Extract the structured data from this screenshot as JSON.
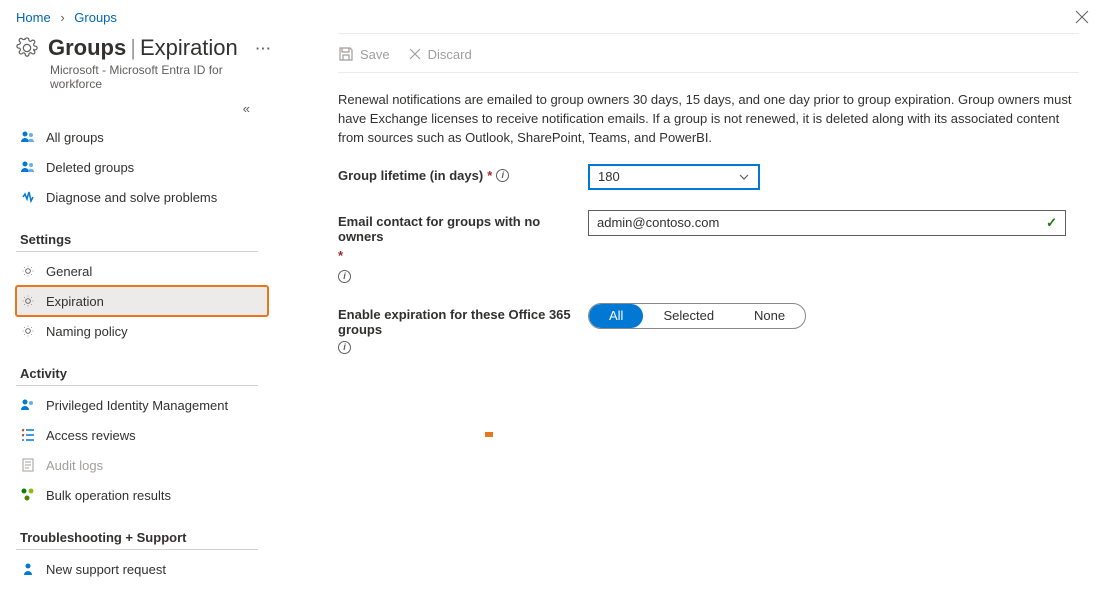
{
  "breadcrumb": {
    "home": "Home",
    "groups": "Groups"
  },
  "header": {
    "title_bold": "Groups",
    "title_rest": "Expiration",
    "subtitle": "Microsoft - Microsoft Entra ID for workforce"
  },
  "sidebar": {
    "top": [
      {
        "label": "All groups"
      },
      {
        "label": "Deleted groups"
      },
      {
        "label": "Diagnose and solve problems"
      }
    ],
    "section_settings": "Settings",
    "settings": [
      {
        "label": "General"
      },
      {
        "label": "Expiration"
      },
      {
        "label": "Naming policy"
      }
    ],
    "section_activity": "Activity",
    "activity": [
      {
        "label": "Privileged Identity Management"
      },
      {
        "label": "Access reviews"
      },
      {
        "label": "Audit logs"
      },
      {
        "label": "Bulk operation results"
      }
    ],
    "section_troubleshoot": "Troubleshooting + Support",
    "support": [
      {
        "label": "New support request"
      }
    ]
  },
  "toolbar": {
    "save": "Save",
    "discard": "Discard"
  },
  "info": "Renewal notifications are emailed to group owners 30 days, 15 days, and one day prior to group expiration. Group owners must have Exchange licenses to receive notification emails. If a group is not renewed, it is deleted along with its associated content from sources such as Outlook, SharePoint, Teams, and PowerBI.",
  "form": {
    "lifetime_label": "Group lifetime (in days)",
    "lifetime_value": "180",
    "email_label": "Email contact for groups with no owners",
    "email_value": "admin@contoso.com",
    "enable_label": "Enable expiration for these Office 365 groups",
    "options": {
      "all": "All",
      "selected": "Selected",
      "none": "None"
    }
  }
}
